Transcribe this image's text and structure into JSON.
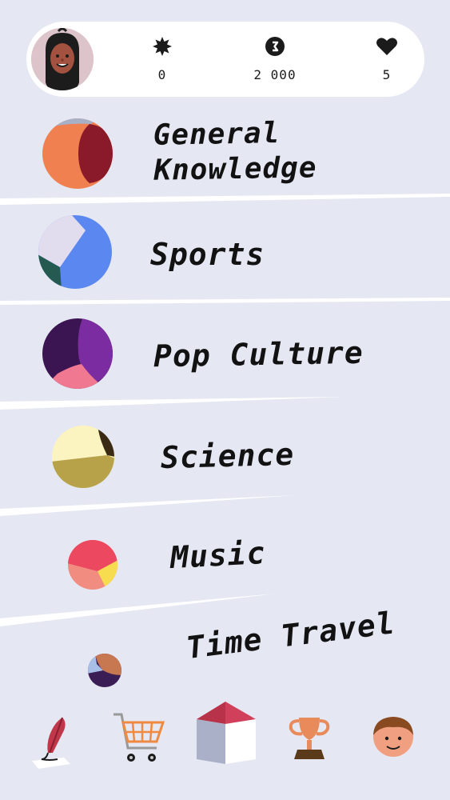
{
  "header": {
    "avatar_icon": "player-avatar-icon",
    "stats": [
      {
        "icon": "star-burst-icon",
        "value": "0"
      },
      {
        "icon": "coin-icon",
        "value": "2 000"
      },
      {
        "icon": "heart-icon",
        "value": "5"
      }
    ]
  },
  "categories": [
    {
      "label_line1": "General",
      "label_line2": "Knowledge",
      "colors": [
        "#f08050",
        "#8a1a2a",
        "#a8b0c8"
      ]
    },
    {
      "label": "Sports",
      "colors": [
        "#5b87f0",
        "#e2dcef",
        "#255a50"
      ]
    },
    {
      "label": "Pop Culture",
      "colors": [
        "#3b1552",
        "#7a2ca0",
        "#f07890"
      ]
    },
    {
      "label": "Science",
      "colors": [
        "#fbf3c0",
        "#b7a24a",
        "#3a2a14"
      ]
    },
    {
      "label": "Music",
      "colors": [
        "#f08c80",
        "#ec4860",
        "#f8dc50"
      ]
    },
    {
      "label": "Time Travel",
      "colors": [
        "#3b1d55",
        "#c87850",
        "#a8c0e8"
      ]
    }
  ],
  "nav": [
    {
      "icon": "quill-icon"
    },
    {
      "icon": "shopping-cart-icon"
    },
    {
      "icon": "home-icon"
    },
    {
      "icon": "trophy-icon"
    },
    {
      "icon": "profile-face-icon"
    }
  ]
}
